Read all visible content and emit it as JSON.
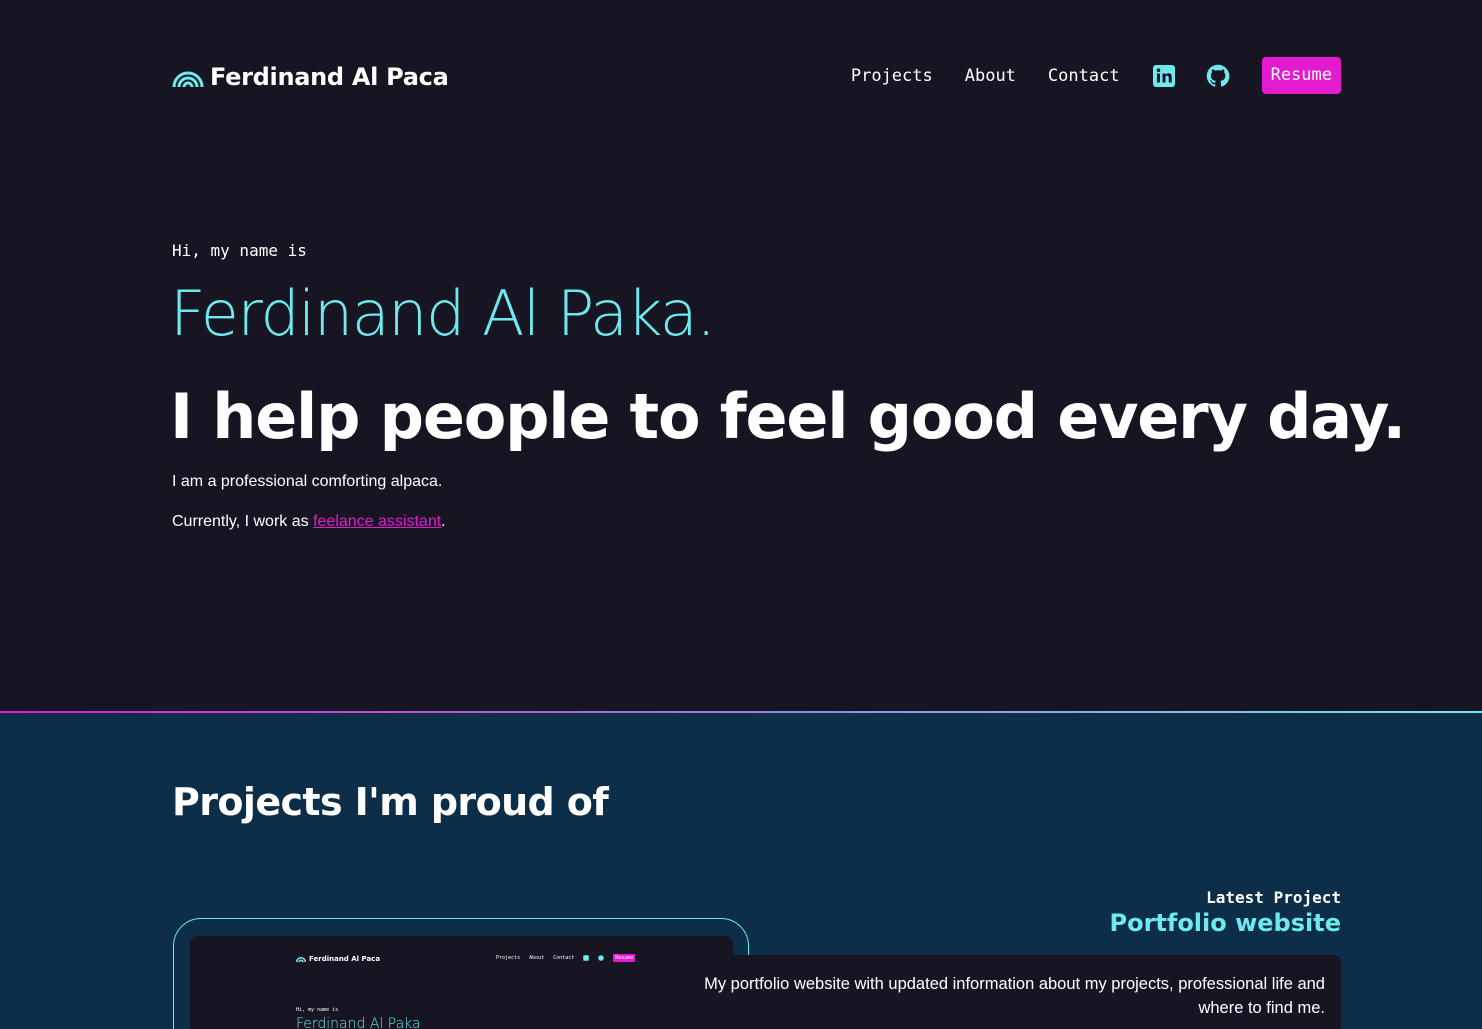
{
  "header": {
    "brand_name": "Ferdinand Al Paca",
    "logo_icon": "rainbow-arch-icon",
    "nav": {
      "projects": "Projects",
      "about": "About",
      "contact": "Contact",
      "linkedin_icon": "linkedin-icon",
      "github_icon": "github-icon",
      "resume": "Resume"
    }
  },
  "hero": {
    "greeting": "Hi, my name is",
    "name": "Ferdinand Al Paka.",
    "tagline": "I help people to feel good every day.",
    "intro": "I am a professional comforting alpaca.",
    "current_prefix": "Currently, I work as ",
    "current_link": "feelance assistant",
    "current_suffix": "."
  },
  "projects": {
    "title": "Projects I'm proud of",
    "latest_label": "Latest Project",
    "latest_name": "Portfolio website",
    "description": "My portfolio website with updated information about my projects, professional life and where to find me.",
    "preview": {
      "brand_name": "Ferdinand Al Paca",
      "nav_projects": "Projects",
      "nav_about": "About",
      "nav_contact": "Contact",
      "resume": "Resume",
      "greeting": "Hi, my name is",
      "name": "Ferdinand Al Paka"
    }
  },
  "colors": {
    "background": "#181523",
    "projects_background": "#0d2e48",
    "accent_cyan": "#6ee9f0",
    "accent_magenta": "#e21bd0"
  }
}
